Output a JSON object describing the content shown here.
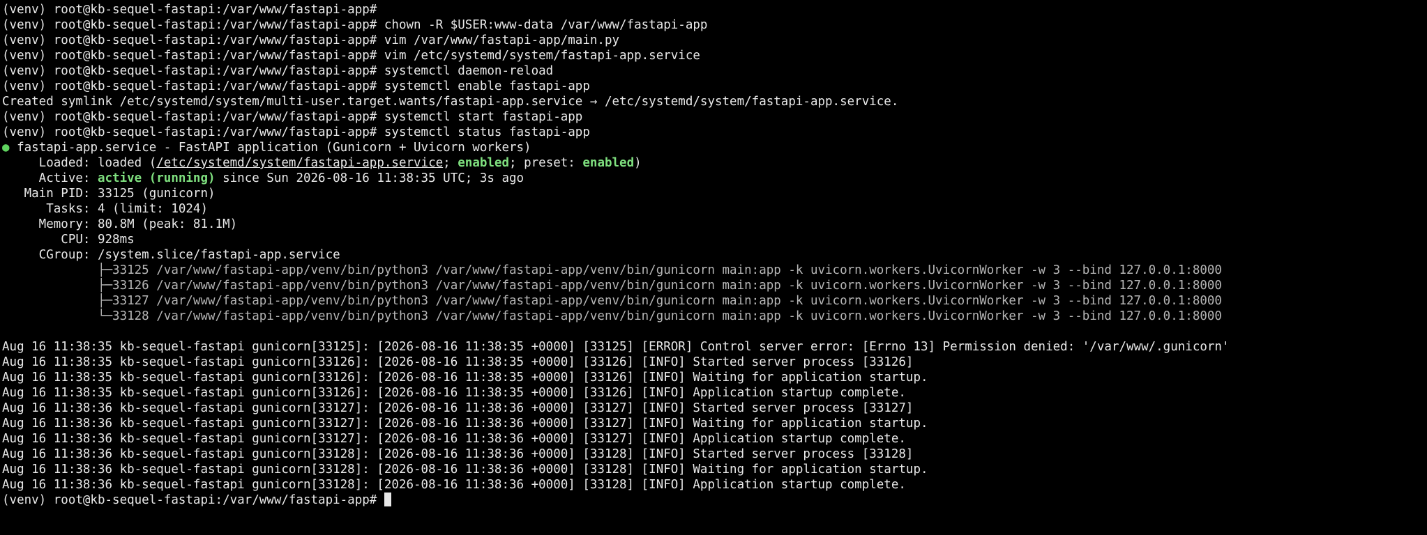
{
  "history": [
    "(venv) root@kb-sequel-fastapi:/var/www/fastapi-app#",
    "(venv) root@kb-sequel-fastapi:/var/www/fastapi-app# chown -R $USER:www-data /var/www/fastapi-app",
    "(venv) root@kb-sequel-fastapi:/var/www/fastapi-app# vim /var/www/fastapi-app/main.py",
    "(venv) root@kb-sequel-fastapi:/var/www/fastapi-app# vim /etc/systemd/system/fastapi-app.service",
    "(venv) root@kb-sequel-fastapi:/var/www/fastapi-app# systemctl daemon-reload",
    "(venv) root@kb-sequel-fastapi:/var/www/fastapi-app# systemctl enable fastapi-app",
    "Created symlink /etc/systemd/system/multi-user.target.wants/fastapi-app.service → /etc/systemd/system/fastapi-app.service.",
    "(venv) root@kb-sequel-fastapi:/var/www/fastapi-app# systemctl start fastapi-app",
    "(venv) root@kb-sequel-fastapi:/var/www/fastapi-app# systemctl status fastapi-app"
  ],
  "status": {
    "dot": "●",
    "unit_line": " fastapi-app.service - FastAPI application (Gunicorn + Uvicorn workers)",
    "loaded_prefix": "     Loaded: loaded (",
    "loaded_path": "/etc/systemd/system/fastapi-app.service",
    "loaded_sep1": "; ",
    "loaded_enabled": "enabled",
    "loaded_sep2": "; preset: ",
    "loaded_preset": "enabled",
    "loaded_suffix": ")",
    "active_prefix": "     Active: ",
    "active_state": "active (running)",
    "active_suffix": " since Sun 2026-08-16 11:38:35 UTC; 3s ago",
    "main_pid": "   Main PID: 33125 (gunicorn)",
    "tasks": "      Tasks: 4 (limit: 1024)",
    "memory": "     Memory: 80.8M (peak: 81.1M)",
    "cpu": "        CPU: 928ms",
    "cgroup": "     CGroup: /system.slice/fastapi-app.service",
    "processes": [
      "             ├─33125 /var/www/fastapi-app/venv/bin/python3 /var/www/fastapi-app/venv/bin/gunicorn main:app -k uvicorn.workers.UvicornWorker -w 3 --bind 127.0.0.1:8000",
      "             ├─33126 /var/www/fastapi-app/venv/bin/python3 /var/www/fastapi-app/venv/bin/gunicorn main:app -k uvicorn.workers.UvicornWorker -w 3 --bind 127.0.0.1:8000",
      "             ├─33127 /var/www/fastapi-app/venv/bin/python3 /var/www/fastapi-app/venv/bin/gunicorn main:app -k uvicorn.workers.UvicornWorker -w 3 --bind 127.0.0.1:8000",
      "             └─33128 /var/www/fastapi-app/venv/bin/python3 /var/www/fastapi-app/venv/bin/gunicorn main:app -k uvicorn.workers.UvicornWorker -w 3 --bind 127.0.0.1:8000"
    ]
  },
  "logs": [
    "Aug 16 11:38:35 kb-sequel-fastapi gunicorn[33125]: [2026-08-16 11:38:35 +0000] [33125] [ERROR] Control server error: [Errno 13] Permission denied: '/var/www/.gunicorn'",
    "Aug 16 11:38:35 kb-sequel-fastapi gunicorn[33126]: [2026-08-16 11:38:35 +0000] [33126] [INFO] Started server process [33126]",
    "Aug 16 11:38:35 kb-sequel-fastapi gunicorn[33126]: [2026-08-16 11:38:35 +0000] [33126] [INFO] Waiting for application startup.",
    "Aug 16 11:38:35 kb-sequel-fastapi gunicorn[33126]: [2026-08-16 11:38:35 +0000] [33126] [INFO] Application startup complete.",
    "Aug 16 11:38:36 kb-sequel-fastapi gunicorn[33127]: [2026-08-16 11:38:36 +0000] [33127] [INFO] Started server process [33127]",
    "Aug 16 11:38:36 kb-sequel-fastapi gunicorn[33127]: [2026-08-16 11:38:36 +0000] [33127] [INFO] Waiting for application startup.",
    "Aug 16 11:38:36 kb-sequel-fastapi gunicorn[33127]: [2026-08-16 11:38:36 +0000] [33127] [INFO] Application startup complete.",
    "Aug 16 11:38:36 kb-sequel-fastapi gunicorn[33128]: [2026-08-16 11:38:36 +0000] [33128] [INFO] Started server process [33128]",
    "Aug 16 11:38:36 kb-sequel-fastapi gunicorn[33128]: [2026-08-16 11:38:36 +0000] [33128] [INFO] Waiting for application startup.",
    "Aug 16 11:38:36 kb-sequel-fastapi gunicorn[33128]: [2026-08-16 11:38:36 +0000] [33128] [INFO] Application startup complete."
  ],
  "prompt": {
    "text": "(venv) root@kb-sequel-fastapi:/var/www/fastapi-app# "
  },
  "colors": {
    "background": "#000000",
    "text": "#e8e8e8",
    "highlight_green": "#7fe07f",
    "status_dot": "#5fd35f",
    "process_text": "#b5b5b5"
  }
}
